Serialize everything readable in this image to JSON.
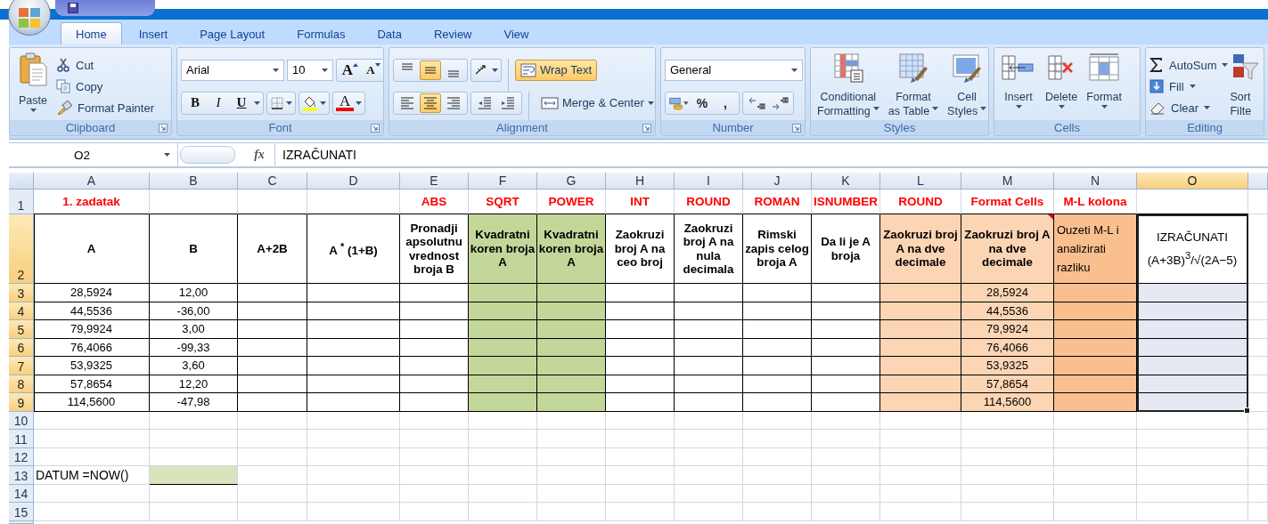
{
  "tabs": [
    {
      "label": "Home",
      "selected": true
    },
    {
      "label": "Insert",
      "selected": false
    },
    {
      "label": "Page Layout",
      "selected": false
    },
    {
      "label": "Formulas",
      "selected": false
    },
    {
      "label": "Data",
      "selected": false
    },
    {
      "label": "Review",
      "selected": false
    },
    {
      "label": "View",
      "selected": false
    }
  ],
  "ribbon": {
    "groups": [
      {
        "kind": "clipboard",
        "label": "Clipboard",
        "launcher": true,
        "paste": "Paste",
        "items": [
          {
            "kind": "cut",
            "label": "Cut"
          },
          {
            "kind": "copy",
            "label": "Copy"
          },
          {
            "kind": "format-painter",
            "label": "Format Painter"
          }
        ]
      },
      {
        "kind": "font",
        "label": "Font",
        "launcher": true,
        "font": "Arial",
        "size": "10",
        "grow": "A",
        "shrink": "A",
        "styles": [
          {
            "kind": "bold",
            "label": "B"
          },
          {
            "kind": "italic",
            "label": "I"
          },
          {
            "kind": "underline",
            "label": "U"
          }
        ],
        "font_color": "A"
      },
      {
        "kind": "alignment",
        "label": "Alignment",
        "launcher": true,
        "vertical": [
          {
            "kind": "top",
            "selected": false
          },
          {
            "kind": "middle",
            "selected": true
          },
          {
            "kind": "bottom",
            "selected": false
          }
        ],
        "horizontal": [
          {
            "kind": "left",
            "selected": false
          },
          {
            "kind": "center",
            "selected": true
          },
          {
            "kind": "right",
            "selected": false
          }
        ],
        "wrap_text": {
          "label": "Wrap Text",
          "selected": true
        },
        "merge": {
          "label": "Merge & Center"
        }
      },
      {
        "kind": "number",
        "label": "Number",
        "launcher": true,
        "format": "General",
        "percent": "%",
        "comma": ","
      },
      {
        "kind": "styles",
        "label": "Styles",
        "launcher": false,
        "buttons": [
          {
            "kind": "conditional",
            "lines": [
              "Conditional",
              "Formatting"
            ]
          },
          {
            "kind": "table",
            "lines": [
              "Format",
              "as Table"
            ]
          },
          {
            "kind": "cell-styles",
            "lines": [
              "Cell",
              "Styles"
            ]
          }
        ]
      },
      {
        "kind": "cells",
        "label": "Cells",
        "launcher": false,
        "buttons": [
          {
            "kind": "insert",
            "label": "Insert"
          },
          {
            "kind": "delete",
            "label": "Delete"
          },
          {
            "kind": "format",
            "label": "Format"
          }
        ]
      },
      {
        "kind": "editing",
        "label": "Editing",
        "launcher": false,
        "items": [
          {
            "kind": "autosum",
            "label": "AutoSum"
          },
          {
            "kind": "fill",
            "label": "Fill"
          },
          {
            "kind": "clear",
            "label": "Clear"
          }
        ],
        "sort": [
          "Sort",
          "Filte"
        ]
      }
    ]
  },
  "formula_bar": {
    "name_box": "O2",
    "function_label": "fx",
    "formula": "IZRAČUNATI"
  },
  "sheet": {
    "columns": [
      {
        "letter": "A",
        "selected": false
      },
      {
        "letter": "B",
        "selected": false
      },
      {
        "letter": "C",
        "selected": false
      },
      {
        "letter": "D",
        "selected": false
      },
      {
        "letter": "E",
        "selected": false
      },
      {
        "letter": "F",
        "selected": false
      },
      {
        "letter": "G",
        "selected": false
      },
      {
        "letter": "H",
        "selected": false
      },
      {
        "letter": "I",
        "selected": false
      },
      {
        "letter": "J",
        "selected": false
      },
      {
        "letter": "K",
        "selected": false
      },
      {
        "letter": "L",
        "selected": false
      },
      {
        "letter": "M",
        "selected": false
      },
      {
        "letter": "N",
        "selected": false
      },
      {
        "letter": "O",
        "selected": true
      }
    ],
    "rows": [
      {
        "number": "1",
        "selected": false,
        "kind": "title",
        "cells": [
          {
            "text": "1. zadatak"
          },
          {},
          {},
          {},
          {
            "text": "ABS"
          },
          {
            "text": "SQRT"
          },
          {
            "text": "POWER"
          },
          {
            "text": "INT"
          },
          {
            "text": "ROUND"
          },
          {
            "text": "ROMAN"
          },
          {
            "text": "ISNUMBER"
          },
          {
            "text": "ROUND"
          },
          {
            "text": "Format Cells"
          },
          {
            "text": "M-L kolona"
          },
          {}
        ]
      },
      {
        "number": "2",
        "selected": true,
        "kind": "header",
        "cells": [
          {
            "kind": "label",
            "text": "A",
            "comment": false
          },
          {
            "kind": "label",
            "text": "B",
            "comment": false
          },
          {
            "kind": "label",
            "text": "A+2B",
            "comment": false
          },
          {
            "kind": "label",
            "text": "A $^{*}$ (1+B)",
            "comment": false
          },
          {
            "kind": "label",
            "text": "Pronadji apsolutnu vrednost broja B",
            "comment": false
          },
          {
            "kind": "label",
            "text": "Kvadratni koren broja A",
            "color": "#c4d79b",
            "comment": false
          },
          {
            "kind": "label",
            "text": "Kvadratni koren broja A",
            "color": "#c4d79b",
            "comment": false
          },
          {
            "kind": "label",
            "text": "Zaokruzi broj A na ceo broj",
            "comment": false
          },
          {
            "kind": "label",
            "text": "Zaokruzi broj A na nula decimala",
            "comment": false
          },
          {
            "kind": "label",
            "text": "Rimski zapis celog broja A",
            "comment": false
          },
          {
            "kind": "label",
            "text": "Da li je A broja",
            "comment": false
          },
          {
            "kind": "label",
            "text": "Zaokruzi broj A na dve decimale",
            "color": "#fcd5b4",
            "comment": false
          },
          {
            "kind": "label",
            "text": "Zaokruzi broj A na dve decimale",
            "color": "#fcd5b4",
            "comment": true
          },
          {
            "kind": "note",
            "text": "Ouzeti M-L i analizirati razliku",
            "color": "#fabf8f",
            "comment": false
          },
          {
            "kind": "formula",
            "text": "IZRAČUNATI\n(A+3B)$^{3}$/√(2A−5)",
            "comment": false
          }
        ]
      },
      {
        "number": "3",
        "selected": true,
        "kind": "data",
        "cells": [
          {
            "text": "28,5924"
          },
          {
            "text": "12,00"
          },
          {},
          {},
          {},
          {
            "color": "#c4d79b"
          },
          {
            "color": "#c4d79b"
          },
          {},
          {},
          {},
          {},
          {
            "color": "#fcd5b4"
          },
          {
            "text": "28,5924",
            "color": "#fcd5b4"
          },
          {
            "color": "#fabf8f"
          },
          {
            "color": "#e6e9f3"
          }
        ]
      },
      {
        "number": "4",
        "selected": true,
        "kind": "data",
        "cells": [
          {
            "text": "44,5536"
          },
          {
            "text": "-36,00"
          },
          {},
          {},
          {},
          {
            "color": "#c4d79b"
          },
          {
            "color": "#c4d79b"
          },
          {},
          {},
          {},
          {},
          {
            "color": "#fcd5b4"
          },
          {
            "text": "44,5536",
            "color": "#fcd5b4"
          },
          {
            "color": "#fabf8f"
          },
          {
            "color": "#e6e9f3"
          }
        ]
      },
      {
        "number": "5",
        "selected": true,
        "kind": "data",
        "cells": [
          {
            "text": "79,9924"
          },
          {
            "text": "3,00"
          },
          {},
          {},
          {},
          {
            "color": "#c4d79b"
          },
          {
            "color": "#c4d79b"
          },
          {},
          {},
          {},
          {},
          {
            "color": "#fcd5b4"
          },
          {
            "text": "79,9924",
            "color": "#fcd5b4"
          },
          {
            "color": "#fabf8f"
          },
          {
            "color": "#e6e9f3"
          }
        ]
      },
      {
        "number": "6",
        "selected": true,
        "kind": "data",
        "cells": [
          {
            "text": "76,4066"
          },
          {
            "text": "-99,33"
          },
          {},
          {},
          {},
          {
            "color": "#c4d79b"
          },
          {
            "color": "#c4d79b"
          },
          {},
          {},
          {},
          {},
          {
            "color": "#fcd5b4"
          },
          {
            "text": "76,4066",
            "color": "#fcd5b4"
          },
          {
            "color": "#fabf8f"
          },
          {
            "color": "#e6e9f3"
          }
        ]
      },
      {
        "number": "7",
        "selected": true,
        "kind": "data",
        "cells": [
          {
            "text": "53,9325"
          },
          {
            "text": "3,60"
          },
          {},
          {},
          {},
          {
            "color": "#c4d79b"
          },
          {
            "color": "#c4d79b"
          },
          {},
          {},
          {},
          {},
          {
            "color": "#fcd5b4"
          },
          {
            "text": "53,9325",
            "color": "#fcd5b4"
          },
          {
            "color": "#fabf8f"
          },
          {
            "color": "#e6e9f3"
          }
        ]
      },
      {
        "number": "8",
        "selected": true,
        "kind": "data",
        "cells": [
          {
            "text": "57,8654"
          },
          {
            "text": "12,20"
          },
          {},
          {},
          {},
          {
            "color": "#c4d79b"
          },
          {
            "color": "#c4d79b"
          },
          {},
          {},
          {},
          {},
          {
            "color": "#fcd5b4"
          },
          {
            "text": "57,8654",
            "color": "#fcd5b4"
          },
          {
            "color": "#fabf8f"
          },
          {
            "color": "#e6e9f3"
          }
        ]
      },
      {
        "number": "9",
        "selected": true,
        "kind": "data",
        "cells": [
          {
            "text": "114,5600"
          },
          {
            "text": "-47,98"
          },
          {},
          {},
          {},
          {
            "color": "#c4d79b"
          },
          {
            "color": "#c4d79b"
          },
          {},
          {},
          {},
          {},
          {
            "color": "#fcd5b4"
          },
          {
            "text": "114,5600",
            "color": "#fcd5b4"
          },
          {
            "color": "#fabf8f"
          },
          {
            "color": "#e6e9f3"
          }
        ]
      },
      {
        "number": "10",
        "selected": false,
        "kind": "blank",
        "cells": []
      },
      {
        "number": "11",
        "selected": false,
        "kind": "blank",
        "cells": []
      },
      {
        "number": "12",
        "selected": false,
        "kind": "blank",
        "cells": []
      },
      {
        "number": "13",
        "selected": false,
        "kind": "blank",
        "cells": [
          {
            "text": "DATUM =NOW()"
          },
          {
            "color": "#d8e4bc",
            "underline": true
          }
        ]
      },
      {
        "number": "14",
        "selected": false,
        "kind": "blank",
        "cells": []
      },
      {
        "number": "15",
        "selected": false,
        "kind": "blank",
        "cells": []
      }
    ]
  }
}
